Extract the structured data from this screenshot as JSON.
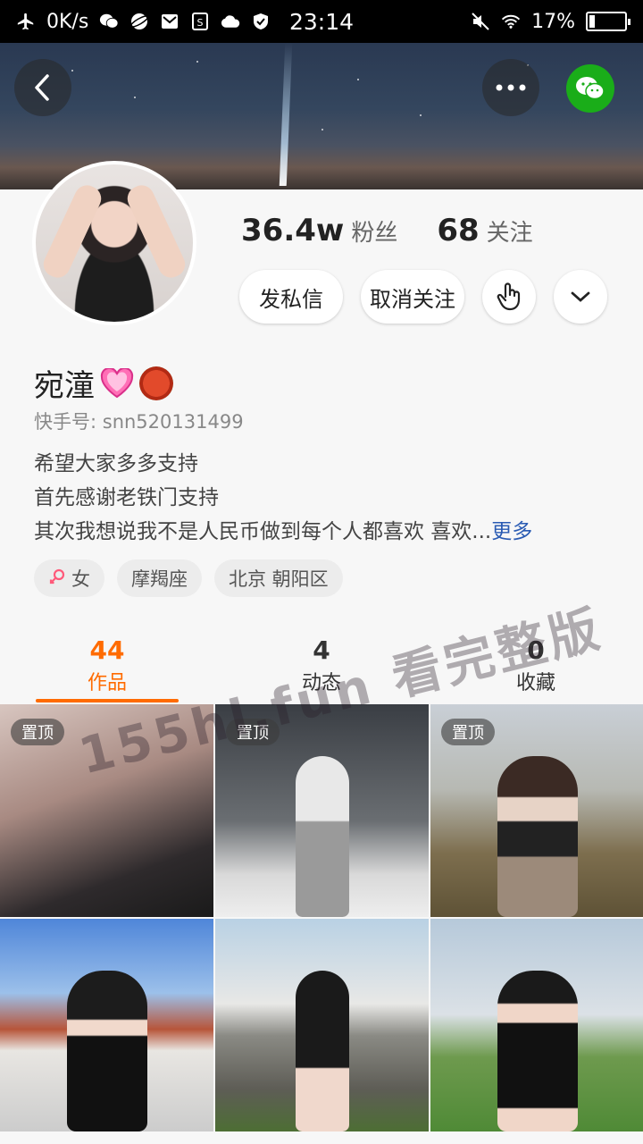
{
  "status_bar": {
    "net_speed": "0K/s",
    "time": "23:14",
    "battery_text": "17%",
    "battery_level": 0.17
  },
  "profile": {
    "followers_count": "36.4w",
    "followers_label": "粉丝",
    "following_count": "68",
    "following_label": "关注",
    "message_button": "发私信",
    "unfollow_button": "取消关注",
    "name": "宛潼",
    "kuaishou_id": "快手号: snn520131499",
    "bio": [
      "希望大家多多支持",
      "首先感谢老铁门支持",
      "其次我想说我不是人民币做到每个人都喜欢 喜欢..."
    ],
    "bio_more": "更多",
    "tags": [
      "女",
      "摩羯座",
      "北京 朝阳区"
    ]
  },
  "tabs": [
    {
      "count": "44",
      "label": "作品"
    },
    {
      "count": "4",
      "label": "动态"
    },
    {
      "count": "0",
      "label": "收藏"
    }
  ],
  "grid": {
    "pinned_label": "置顶"
  },
  "watermark": "155hl.fun 看完整版",
  "colors": {
    "accent": "#ff6b00",
    "link": "#2a5bb3",
    "wechat": "#1aad19"
  }
}
